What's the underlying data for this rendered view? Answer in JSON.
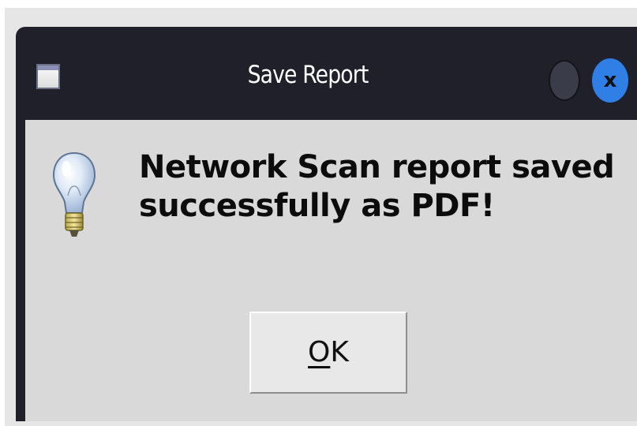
{
  "window": {
    "title": "Save Report",
    "close_glyph": "x",
    "icon": "window-app-icon"
  },
  "dialog": {
    "icon": "lightbulb-info-icon",
    "message": "Network Scan report saved\nsuccessfully as PDF!"
  },
  "buttons": {
    "ok_mnemonic": "O",
    "ok_rest": "K"
  },
  "colors": {
    "titlebar": "#1f2029",
    "client_bg": "#d9d9d9",
    "close_button": "#2f7fe7",
    "minimize_button": "#3a3c4a"
  }
}
